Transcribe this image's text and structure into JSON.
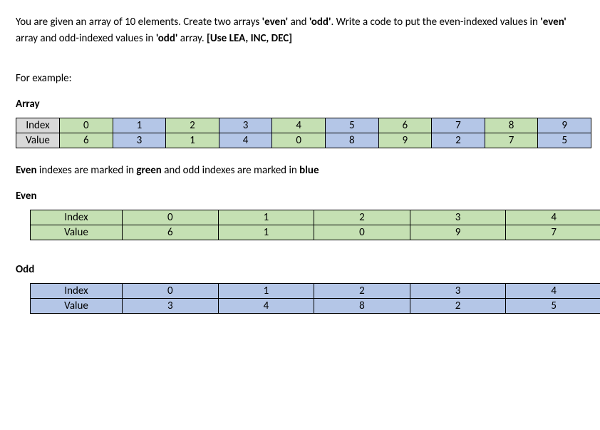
{
  "prompt": {
    "p1a": "You are given an array of 10 elements. Create two arrays ",
    "b1": "'even'",
    "p1b": " and ",
    "b2": "'odd'",
    "p1c": ". Write a code to put the even-indexed values in ",
    "b3": "'even'",
    "p1d": " array and odd-indexed values in ",
    "b4": "'odd'",
    "p1e": " array. ",
    "b5": "[Use LEA, INC, DEC]"
  },
  "labels": {
    "for_example": "For example:",
    "array": "Array",
    "even": "Even",
    "odd": "Odd",
    "index": "Index",
    "value": "Value"
  },
  "explain": {
    "a": "Even",
    "b": " indexes are marked in ",
    "c": "green",
    "d": " and odd indexes are marked in ",
    "e": "blue"
  },
  "array": {
    "idx": [
      "0",
      "1",
      "2",
      "3",
      "4",
      "5",
      "6",
      "7",
      "8",
      "9"
    ],
    "val": [
      "6",
      "3",
      "1",
      "4",
      "0",
      "8",
      "9",
      "2",
      "7",
      "5"
    ]
  },
  "even_tbl": {
    "idx": [
      "0",
      "1",
      "2",
      "3",
      "4"
    ],
    "val": [
      "6",
      "1",
      "0",
      "9",
      "7"
    ]
  },
  "odd_tbl": {
    "idx": [
      "0",
      "1",
      "2",
      "3",
      "4"
    ],
    "val": [
      "3",
      "4",
      "8",
      "2",
      "5"
    ]
  }
}
